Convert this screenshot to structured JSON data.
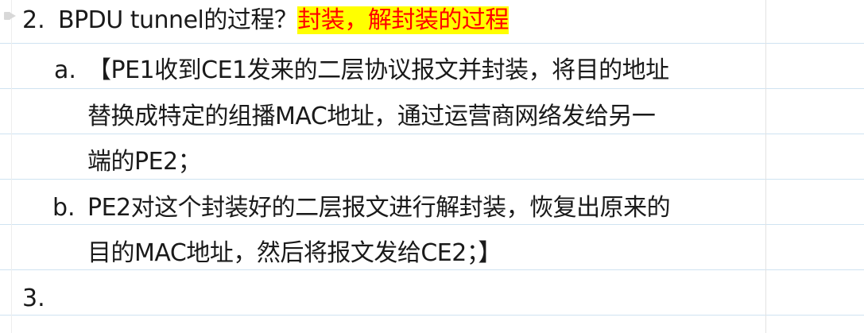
{
  "items": [
    {
      "marker": "2.",
      "text": "BPDU tunnel的过程？",
      "highlight": "封装，解封装的过程",
      "highlight_colors": {
        "text": "#ff0000",
        "background": "#ffff00"
      }
    },
    {
      "marker": "a.",
      "lines": [
        "【PE1收到CE1发来的二层协议报文并封装，将目的地址",
        "替换成特定的组播MAC地址，通过运营商网络发给另一",
        "端的PE2；"
      ]
    },
    {
      "marker": "b.",
      "lines": [
        "PE2对这个封装好的二层报文进行解封装，恢复出原来的",
        "目的MAC地址，然后将报文发给CE2；】"
      ]
    },
    {
      "marker": "3."
    }
  ]
}
